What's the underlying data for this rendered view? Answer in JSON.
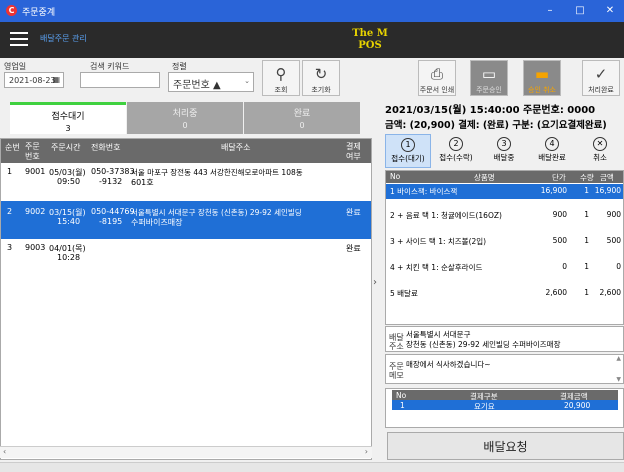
{
  "window": {
    "title": "주문중계",
    "min": "–",
    "max": "□",
    "close": "✕"
  },
  "header": {
    "subtitle": "배달주문 관리",
    "brand_line1": "The M",
    "brand_line2": "POS"
  },
  "toolbar": {
    "date_label": "영업일",
    "date_value": "2021-08-23",
    "keyword_label": "검색 키워드",
    "keyword_value": "",
    "sort_label": "정렬",
    "sort_value": "주문번호 ▲",
    "search_btn": "조회",
    "reset_btn": "초기화",
    "print_btn": "주문서 인쇄",
    "accept_btn": "주문승인",
    "cancel_accept_btn": "승인 취소",
    "complete_btn": "처리완료"
  },
  "tabs": [
    {
      "label": "접수대기",
      "count": "3"
    },
    {
      "label": "처리중",
      "count": "0"
    },
    {
      "label": "완료",
      "count": "0"
    }
  ],
  "order_list": {
    "headers": {
      "seq": "순번",
      "no_1": "주문",
      "no_2": "번호",
      "time": "주문시간",
      "phone": "전화번호",
      "addr": "배달주소",
      "pay_1": "결제",
      "pay_2": "여부"
    },
    "rows": [
      {
        "seq": "1",
        "no": "9001",
        "date": "05/03(월)",
        "time": "09:50",
        "phone1": "050-37383",
        "phone2": "-9132",
        "addr1": "서울 마포구 장전동 443 서강한진해모로아파트 108동",
        "addr2": "601호",
        "paid": ""
      },
      {
        "seq": "2",
        "no": "9002",
        "date": "03/15(월)",
        "time": "15:40",
        "phone1": "050-44769",
        "phone2": "-8195",
        "addr1": "서울특별시 서대문구 장천동 (신촌동) 29-92 세인빌딩",
        "addr2": "수퍼바이즈매장",
        "paid": "완료"
      },
      {
        "seq": "3",
        "no": "9003",
        "date": "04/01(목)",
        "time": "10:28",
        "phone1": "",
        "phone2": "",
        "addr1": "",
        "addr2": "",
        "paid": "완료"
      }
    ]
  },
  "detail": {
    "line1": "2021/03/15(월) 15:40:00   주문번호: 0000",
    "line2": "금액: (20,900)   결제: (완료)   구분: (요기요결제완료)",
    "steps": [
      {
        "num": "1",
        "label": "접수(대기)"
      },
      {
        "num": "2",
        "label": "접수(수락)"
      },
      {
        "num": "3",
        "label": "배달중"
      },
      {
        "num": "4",
        "label": "배달완료"
      },
      {
        "num": "✕",
        "label": "취소"
      }
    ],
    "items_headers": {
      "no": "No",
      "name": "상품명",
      "price": "단가",
      "qty": "수량",
      "amount": "금액"
    },
    "items": [
      {
        "name": "1  바이스잭: 바이스잭",
        "price": "16,900",
        "qty": "1",
        "amount": "16,900"
      },
      {
        "name": "2  + 음료 택 1: 청귤에이드(16OZ)",
        "price": "900",
        "qty": "1",
        "amount": "900"
      },
      {
        "name": "3  + 사이드 택 1: 치즈볼(2입)",
        "price": "500",
        "qty": "1",
        "amount": "500"
      },
      {
        "name": "4  + 치킨 택 1: 순살후라이드",
        "price": "0",
        "qty": "1",
        "amount": "0"
      },
      {
        "name": "5  배달료",
        "price": "2,600",
        "qty": "1",
        "amount": "2,600"
      }
    ],
    "addr_label_1": "배달",
    "addr_label_2": "주소",
    "addr_line1": "서울특별시 서대문구",
    "addr_line2": "장천동 (신촌동) 29-92 세인빌딩 수퍼바이즈매장",
    "memo_label_1": "주문",
    "memo_label_2": "메모",
    "memo": "매장에서 식사하겠습니다~",
    "pay_headers": {
      "no": "No",
      "type": "결제구분",
      "amount": "결제금액"
    },
    "pay_rows": [
      {
        "no": "1",
        "type": "요기요",
        "amount": "20,900"
      }
    ],
    "delivery_request": "배달요청"
  },
  "colors": {
    "titlebar": "#2a64d8",
    "header": "#2a2a2a",
    "accent": "#1f6fd6",
    "brand": "#e8d300",
    "tab_active_bar": "#3fd13f",
    "tab_inactive": "#a6a6a6"
  }
}
